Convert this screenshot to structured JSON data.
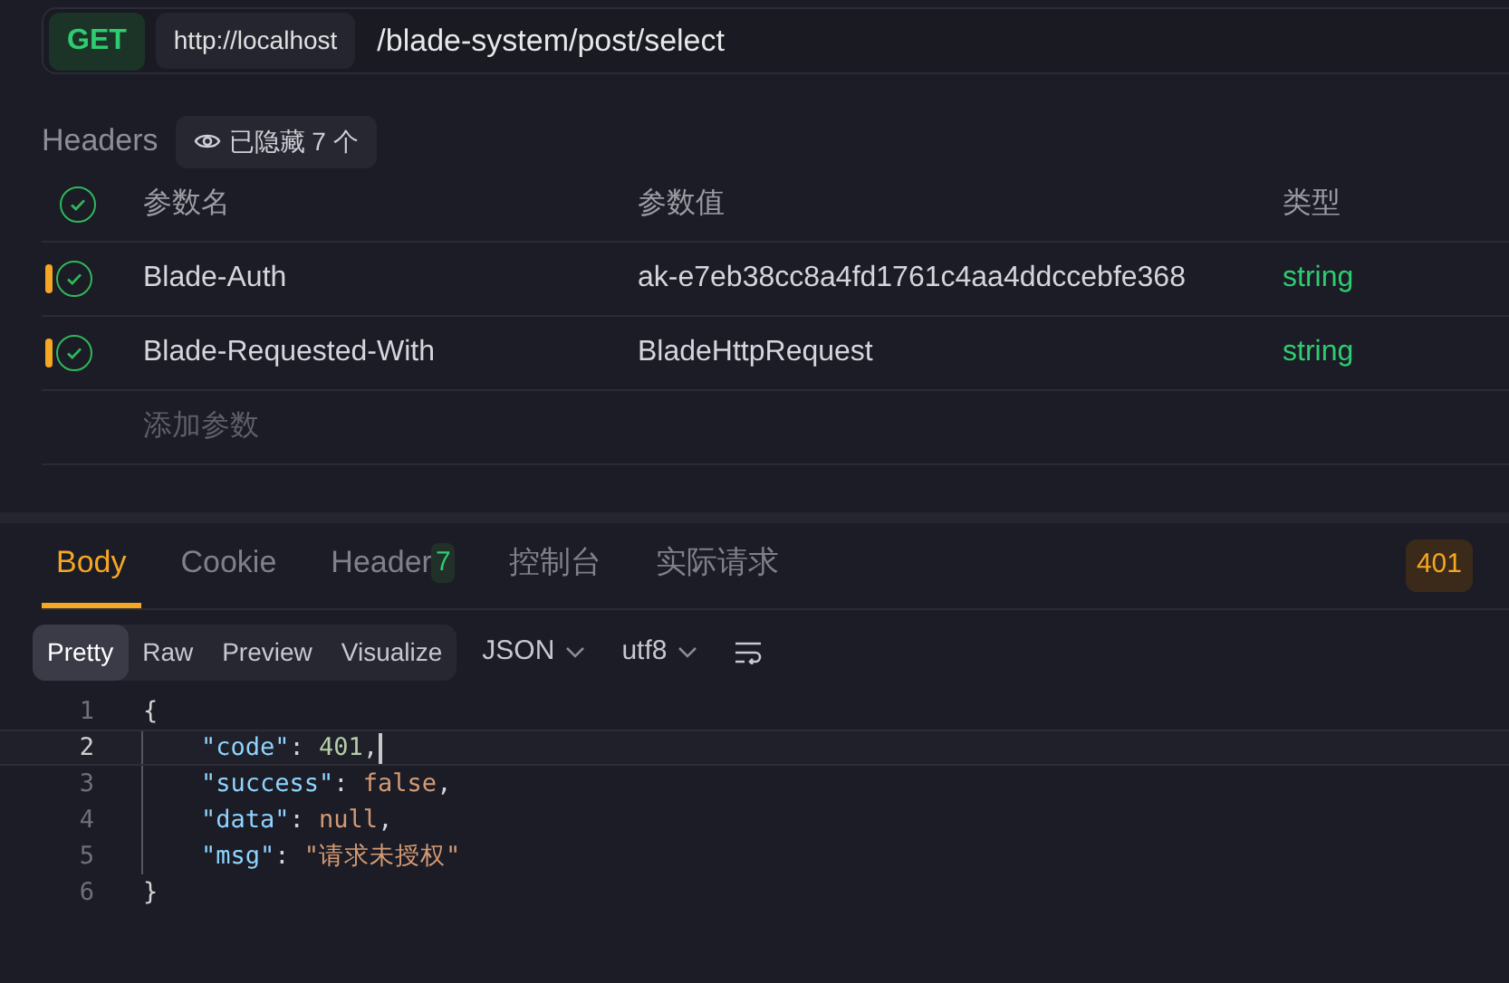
{
  "request": {
    "method": "GET",
    "host": "http://localhost",
    "path": "/blade-system/post/select"
  },
  "headers_bar": {
    "title": "Headers",
    "hidden_label": "已隐藏 7 个"
  },
  "params_table": {
    "all_checked": true,
    "columns": [
      "参数名",
      "参数值",
      "类型"
    ],
    "rows": [
      {
        "checked": true,
        "name": "Blade-Auth",
        "value": "ak-e7eb38cc8a4fd1761c4aa4ddccebfe368",
        "type": "string"
      },
      {
        "checked": true,
        "name": "Blade-Requested-With",
        "value": "BladeHttpRequest",
        "type": "string"
      }
    ],
    "add_placeholder": "添加参数"
  },
  "response_tabs": [
    {
      "label": "Body",
      "selected": true
    },
    {
      "label": "Cookie",
      "selected": false
    },
    {
      "label": "Header",
      "count": "7",
      "selected": false
    },
    {
      "label": "控制台",
      "selected": false
    },
    {
      "label": "实际请求",
      "selected": false
    }
  ],
  "status_code": "401",
  "view_modes": [
    {
      "label": "Pretty",
      "selected": true
    },
    {
      "label": "Raw",
      "selected": false
    },
    {
      "label": "Preview",
      "selected": false
    },
    {
      "label": "Visualize",
      "selected": false
    }
  ],
  "format": "JSON",
  "encoding": "utf8",
  "code_lines": [
    {
      "number": "1",
      "current": false,
      "tokens": [
        {
          "kind": "punct",
          "text": "{"
        }
      ]
    },
    {
      "number": "2",
      "current": true,
      "tokens": [
        {
          "kind": "key",
          "text": "\"code\""
        },
        {
          "kind": "punct",
          "text": ": "
        },
        {
          "kind": "number",
          "text": "401"
        },
        {
          "kind": "punct",
          "text": ","
        }
      ]
    },
    {
      "number": "3",
      "current": false,
      "tokens": [
        {
          "kind": "key",
          "text": "\"success\""
        },
        {
          "kind": "punct",
          "text": ": "
        },
        {
          "kind": "literal",
          "text": "false"
        },
        {
          "kind": "punct",
          "text": ","
        }
      ]
    },
    {
      "number": "4",
      "current": false,
      "tokens": [
        {
          "kind": "key",
          "text": "\"data\""
        },
        {
          "kind": "punct",
          "text": ": "
        },
        {
          "kind": "literal",
          "text": "null"
        },
        {
          "kind": "punct",
          "text": ","
        }
      ]
    },
    {
      "number": "5",
      "current": false,
      "tokens": [
        {
          "kind": "key",
          "text": "\"msg\""
        },
        {
          "kind": "punct",
          "text": ": "
        },
        {
          "kind": "string",
          "text": "\"请求未授权\""
        }
      ]
    },
    {
      "number": "6",
      "current": false,
      "tokens": [
        {
          "kind": "punct",
          "text": "}"
        }
      ]
    }
  ]
}
